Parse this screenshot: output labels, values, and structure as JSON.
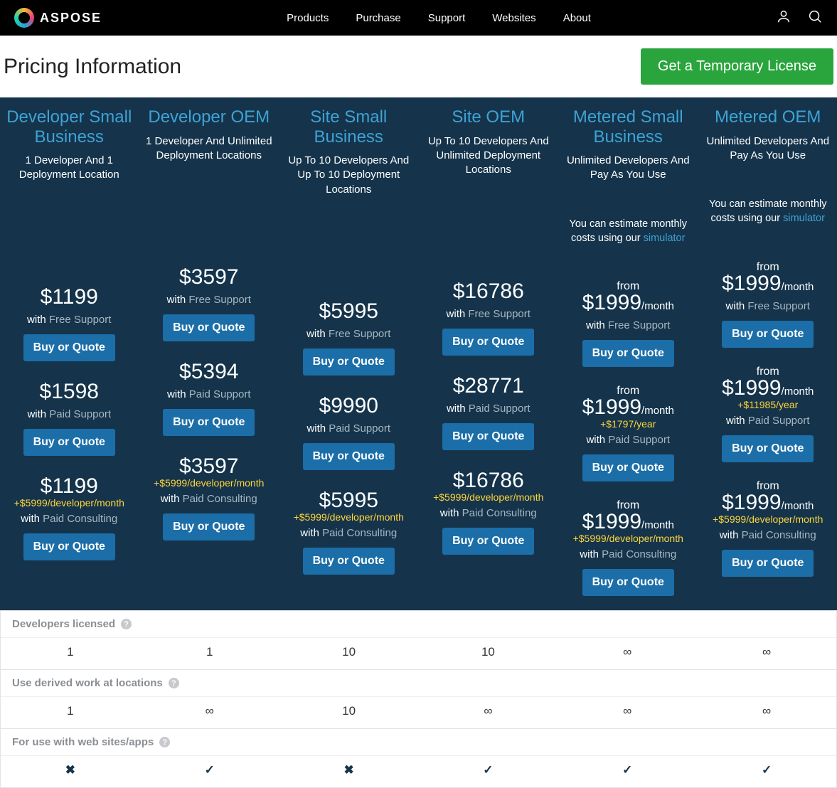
{
  "brand": "ASPOSE",
  "nav": [
    "Products",
    "Purchase",
    "Support",
    "Websites",
    "About"
  ],
  "pageTitle": "Pricing Information",
  "tempLicense": "Get a Temporary License",
  "buyLabel": "Buy or Quote",
  "withWord": "with",
  "fromWord": "from",
  "support": {
    "free": "Free Support",
    "paid": "Paid Support",
    "consulting": "Paid Consulting"
  },
  "estimatePrefix": "You can estimate monthly costs using our ",
  "estimateLink": "simulator",
  "plans": [
    {
      "name": "Developer Small Business",
      "desc": "1 Developer And 1 Deployment Location",
      "metered": false,
      "t1": {
        "price": "$1199"
      },
      "t2": {
        "price": "$1598"
      },
      "t3": {
        "price": "$1199",
        "plus": "+$5999/developer/month"
      }
    },
    {
      "name": "Developer OEM",
      "desc": "1 Developer And Unlimited Deployment Locations",
      "metered": false,
      "t1": {
        "price": "$3597"
      },
      "t2": {
        "price": "$5394"
      },
      "t3": {
        "price": "$3597",
        "plus": "+$5999/developer/month"
      }
    },
    {
      "name": "Site Small Business",
      "desc": "Up To 10 Developers And Up To 10 Deployment Locations",
      "metered": false,
      "t1": {
        "price": "$5995"
      },
      "t2": {
        "price": "$9990"
      },
      "t3": {
        "price": "$5995",
        "plus": "+$5999/developer/month"
      }
    },
    {
      "name": "Site OEM",
      "desc": "Up To 10 Developers And Unlimited Deployment Locations",
      "metered": false,
      "t1": {
        "price": "$16786"
      },
      "t2": {
        "price": "$28771"
      },
      "t3": {
        "price": "$16786",
        "plus": "+$5999/developer/month"
      }
    },
    {
      "name": "Metered Small Business",
      "desc": "Unlimited Developers And Pay As You Use",
      "metered": true,
      "t1": {
        "price": "$1999",
        "per": "/month"
      },
      "t2": {
        "price": "$1999",
        "per": "/month",
        "plus": "+$1797/year"
      },
      "t3": {
        "price": "$1999",
        "per": "/month",
        "plus": "+$5999/developer/month"
      }
    },
    {
      "name": "Metered OEM",
      "desc": "Unlimited Developers And Pay As You Use",
      "metered": true,
      "t1": {
        "price": "$1999",
        "per": "/month"
      },
      "t2": {
        "price": "$1999",
        "per": "/month",
        "plus": "+$11985/year"
      },
      "t3": {
        "price": "$1999",
        "per": "/month",
        "plus": "+$5999/developer/month"
      }
    }
  ],
  "featureRows": [
    {
      "label": "Developers licensed",
      "vals": [
        "1",
        "1",
        "10",
        "10",
        "∞",
        "∞"
      ]
    },
    {
      "label": "Use derived work at locations",
      "vals": [
        "1",
        "∞",
        "10",
        "∞",
        "∞",
        "∞"
      ]
    },
    {
      "label": "For use with web sites/apps",
      "vals": [
        "✕",
        "✓",
        "✕",
        "✓",
        "✓",
        "✓"
      ]
    }
  ]
}
